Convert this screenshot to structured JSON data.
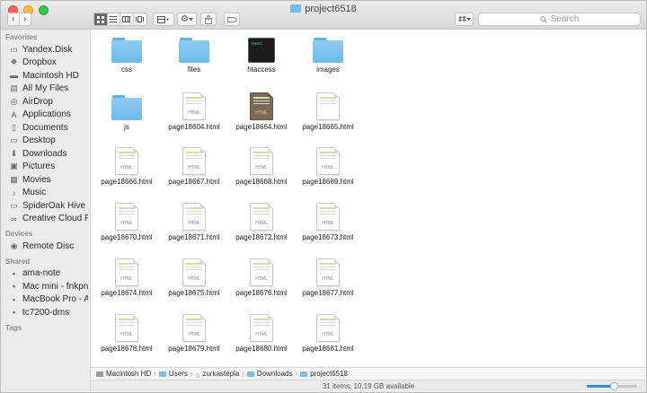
{
  "window": {
    "title": "project6518",
    "lights": [
      "#fc605b",
      "#fdbc40",
      "#34c84a"
    ]
  },
  "toolbar": {
    "back_glyph": "‹",
    "forward_glyph": "›",
    "view_modes": [
      "icon-view",
      "list-view",
      "column-view",
      "cover-flow-view"
    ],
    "arrange_icon": "arrange-icon",
    "action_icon": "gear-icon",
    "share_icon": "share-icon",
    "tag_icon": "tag-icon",
    "dropbox_icon": "dropbox-icon",
    "search_placeholder": "Search"
  },
  "sidebar": {
    "sections": [
      {
        "heading": "Favorites",
        "items": [
          {
            "label": "Yandex.Disk",
            "icon": "folder-icon"
          },
          {
            "label": "Dropbox",
            "icon": "dropbox-icon"
          },
          {
            "label": "Macintosh HD",
            "icon": "disk-icon"
          },
          {
            "label": "All My Files",
            "icon": "all-files-icon"
          },
          {
            "label": "AirDrop",
            "icon": "airdrop-icon"
          },
          {
            "label": "Applications",
            "icon": "applications-icon"
          },
          {
            "label": "Documents",
            "icon": "documents-icon"
          },
          {
            "label": "Desktop",
            "icon": "desktop-icon"
          },
          {
            "label": "Downloads",
            "icon": "downloads-icon"
          },
          {
            "label": "Pictures",
            "icon": "pictures-icon"
          },
          {
            "label": "Movies",
            "icon": "movies-icon"
          },
          {
            "label": "Music",
            "icon": "music-icon"
          },
          {
            "label": "SpiderOak Hive",
            "icon": "folder-icon"
          },
          {
            "label": "Creative Cloud Files",
            "icon": "creative-cloud-icon"
          }
        ]
      },
      {
        "heading": "Devices",
        "items": [
          {
            "label": "Remote Disc",
            "icon": "disc-icon"
          }
        ]
      },
      {
        "heading": "Shared",
        "items": [
          {
            "label": "ama-note",
            "icon": "computer-icon"
          },
          {
            "label": "Mac mini - fnkpnk",
            "icon": "computer-icon"
          },
          {
            "label": "MacBook Pro - Ale...",
            "icon": "computer-icon"
          },
          {
            "label": "tc7200-dms",
            "icon": "computer-icon"
          }
        ]
      },
      {
        "heading": "Tags",
        "items": []
      }
    ]
  },
  "files": [
    {
      "name": "css",
      "kind": "folder"
    },
    {
      "name": "files",
      "kind": "folder"
    },
    {
      "name": "htaccess",
      "kind": "exec",
      "badge": "exec"
    },
    {
      "name": "images",
      "kind": "folder"
    },
    {
      "name": "js",
      "kind": "folder"
    },
    {
      "name": "page18604.html",
      "kind": "html",
      "badge": "HTML"
    },
    {
      "name": "page18664.html",
      "kind": "html-preview",
      "badge": "HTML"
    },
    {
      "name": "page18665.html",
      "kind": "html",
      "badge": ""
    },
    {
      "name": "page18666.html",
      "kind": "html",
      "badge": "HTML"
    },
    {
      "name": "page18667.html",
      "kind": "html",
      "badge": "HTML"
    },
    {
      "name": "page18668.html",
      "kind": "html",
      "badge": "HTML"
    },
    {
      "name": "page18669.html",
      "kind": "html",
      "badge": "HTML"
    },
    {
      "name": "page18670.html",
      "kind": "html",
      "badge": "HTML"
    },
    {
      "name": "page18671.html",
      "kind": "html",
      "badge": "HTML"
    },
    {
      "name": "page18672.html",
      "kind": "html",
      "badge": "HTML"
    },
    {
      "name": "page18673.html",
      "kind": "html",
      "badge": "HTML"
    },
    {
      "name": "page18674.html",
      "kind": "html",
      "badge": "HTML"
    },
    {
      "name": "page18675.html",
      "kind": "html",
      "badge": "HTML"
    },
    {
      "name": "page18676.html",
      "kind": "html",
      "badge": "HTML"
    },
    {
      "name": "page18677.html",
      "kind": "html",
      "badge": "HTML"
    },
    {
      "name": "page18678.html",
      "kind": "html",
      "badge": "HTML"
    },
    {
      "name": "page18679.html",
      "kind": "html",
      "badge": "HTML"
    },
    {
      "name": "page18680.html",
      "kind": "html",
      "badge": "HTML"
    },
    {
      "name": "page18681.html",
      "kind": "html",
      "badge": "HTML"
    }
  ],
  "pathbar": [
    {
      "label": "Macintosh HD",
      "icon": "disk-icon"
    },
    {
      "label": "Users",
      "icon": "folder-icon"
    },
    {
      "label": "zurkastepla",
      "icon": "home-icon"
    },
    {
      "label": "Downloads",
      "icon": "folder-icon"
    },
    {
      "label": "project6518",
      "icon": "folder-icon"
    }
  ],
  "status": {
    "text": "31 items, 10,19 GB available",
    "icon_size_level": 0.55
  }
}
